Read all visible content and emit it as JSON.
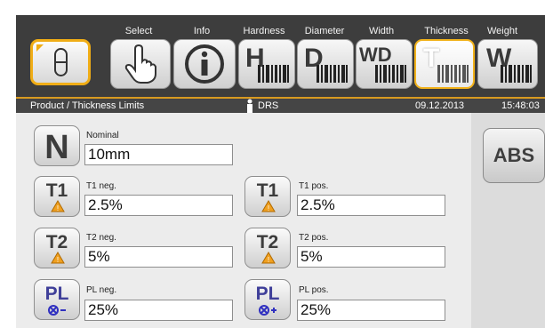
{
  "header": {
    "tabs": [
      {
        "label": "Select",
        "icon": "hand-pointer-icon"
      },
      {
        "label": "Info",
        "icon": "info-icon"
      },
      {
        "label": "Hardness",
        "icon": "hardness-H-icon",
        "letter": "H"
      },
      {
        "label": "Diameter",
        "icon": "diameter-D-icon",
        "letter": "D"
      },
      {
        "label": "Width",
        "icon": "width-WD-icon",
        "letter": "WD"
      },
      {
        "label": "Thickness",
        "icon": "thickness-T-icon",
        "letter": "T",
        "active": true
      },
      {
        "label": "Weight",
        "icon": "weight-W-icon",
        "letter": "W"
      }
    ],
    "home_icon": "product-capsule-icon"
  },
  "status": {
    "breadcrumb": "Product / Thickness Limits",
    "user": "DRS",
    "user_icon": "person-icon",
    "date": "09.12.2013",
    "time": "15:48:03"
  },
  "nominal": {
    "button": "N",
    "label": "Nominal",
    "value": "10mm"
  },
  "t1_neg": {
    "button": "T1",
    "label": "T1 neg.",
    "value": "2.5%"
  },
  "t1_pos": {
    "button": "T1",
    "label": "T1 pos.",
    "value": "2.5%"
  },
  "t2_neg": {
    "button": "T2",
    "label": "T2 neg.",
    "value": "5%"
  },
  "t2_pos": {
    "button": "T2",
    "label": "T2 pos.",
    "value": "5%"
  },
  "pl_neg": {
    "button": "PL",
    "label": "PL neg.",
    "value": "25%"
  },
  "pl_pos": {
    "button": "PL",
    "label": "PL pos.",
    "value": "25%"
  },
  "side": {
    "abs_label": "ABS"
  },
  "colors": {
    "accent": "#f0ad16",
    "warning": "#f0a020",
    "pl_blue": "#3030c0"
  }
}
